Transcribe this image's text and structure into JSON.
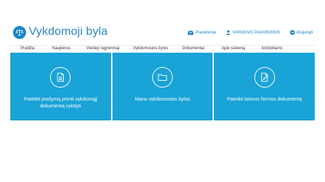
{
  "app": {
    "title": "Vykdomoji byla",
    "logo_icon": "scales-icon",
    "accent_color": "#1a86c7",
    "tile_color": "#1aa3d6"
  },
  "header": {
    "messages_label": "Pranešimai",
    "messages_icon": "envelope-icon",
    "user_name": "VARDENIS PAVARDENIS",
    "user_icon": "user-icon",
    "logout_label": "Atsijungti",
    "logout_icon": "logout-icon"
  },
  "nav": {
    "items": [
      {
        "label": "Pradžia"
      },
      {
        "label": "Naujienos"
      },
      {
        "label": "Viešieji ragininmai"
      },
      {
        "label": "Vykdomosios bylos"
      },
      {
        "label": "Dokumentai"
      },
      {
        "label": "Apie sistemą"
      },
      {
        "label": "Antstoliams"
      }
    ]
  },
  "tiles": [
    {
      "label": "Pateikti prašymą primti vykdomąjį dokumentą vykdyti",
      "icon": "document-stamp-icon"
    },
    {
      "label": "Mano vykdomosios bylos",
      "icon": "folder-icon"
    },
    {
      "label": "Pateikti laisvos formos dokumentą",
      "icon": "document-edit-icon"
    }
  ]
}
